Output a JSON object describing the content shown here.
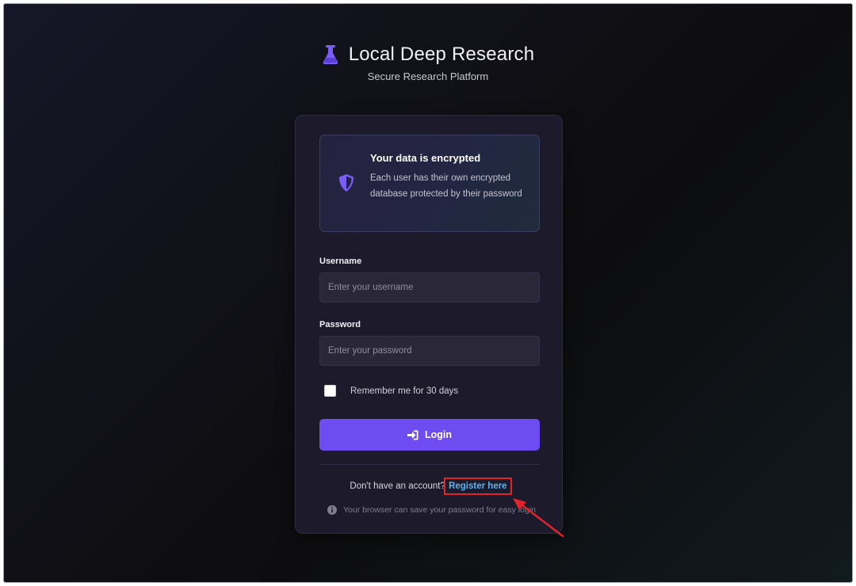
{
  "header": {
    "title": "Local Deep Research",
    "subtitle": "Secure Research Platform",
    "icon": "flask-icon"
  },
  "notice": {
    "icon": "shield-icon",
    "title": "Your data is encrypted",
    "text": "Each user has their own encrypted database protected by their password"
  },
  "form": {
    "username_label": "Username",
    "username_placeholder": "Enter your username",
    "username_value": "",
    "password_label": "Password",
    "password_placeholder": "Enter your password",
    "password_value": "",
    "remember_label": "Remember me for 30 days",
    "remember_checked": false,
    "login_label": "Login",
    "login_icon": "sign-in-icon"
  },
  "footer": {
    "register_prompt": "Don't have an account?",
    "register_link": "Register here",
    "hint_icon": "info-icon",
    "hint": "Your browser can save your password for easy login"
  },
  "colors": {
    "accent": "#6d4cf2",
    "link": "#5ab2f5",
    "annotation": "#e0242c",
    "card": "#1d1b2b"
  }
}
